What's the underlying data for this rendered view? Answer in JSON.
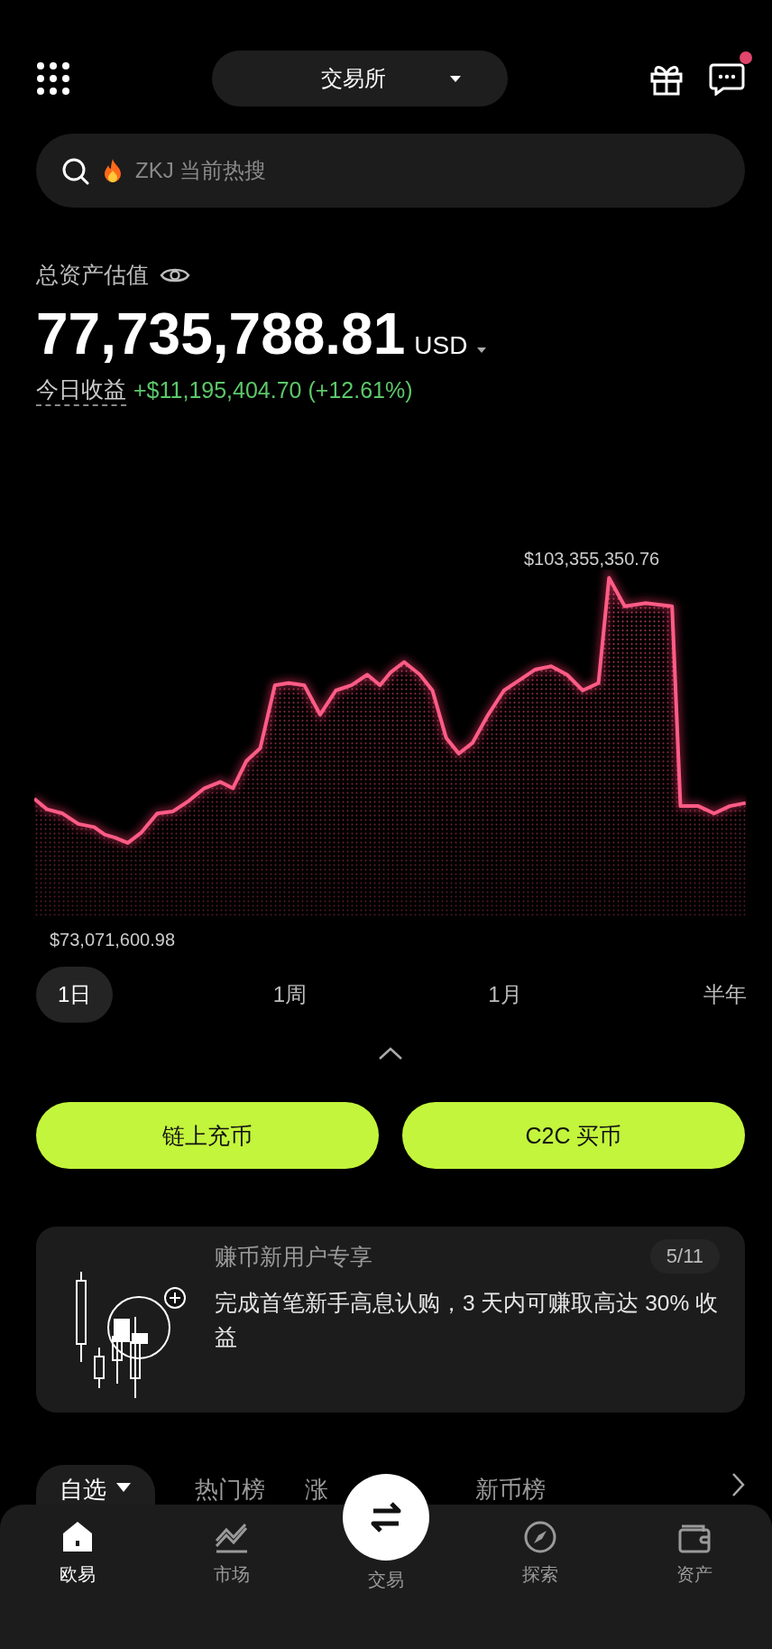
{
  "header": {
    "exchange_selector": "交易所",
    "message_unread": true
  },
  "search": {
    "placeholder": "ZKJ 当前热搜"
  },
  "balance": {
    "label": "总资产估值",
    "amount": "77,735,788.81",
    "currency": "USD",
    "pnl_label": "今日收益",
    "pnl": "+$11,195,404.70 (+12.61%)"
  },
  "chart": {
    "max_label": "$103,355,350.76",
    "min_label": "$73,071,600.98"
  },
  "ranges": [
    {
      "label": "1日",
      "selected": true
    },
    {
      "label": "1周",
      "selected": false
    },
    {
      "label": "1月",
      "selected": false
    },
    {
      "label": "半年",
      "selected": false
    }
  ],
  "actions": [
    "链上充币",
    "C2C 买币"
  ],
  "promo": {
    "title": "赚币新用户专享",
    "page": "5/11",
    "text": "完成首笔新手高息认购，3 天内可赚取高达 30% 收益"
  },
  "market_tabs": [
    {
      "label": "自选",
      "selected": true,
      "dropdown": true
    },
    {
      "label": "热门榜",
      "selected": false,
      "dropdown": false
    },
    {
      "label": "涨",
      "selected": false,
      "dropdown": false
    },
    {
      "label": "新币榜",
      "selected": false,
      "dropdown": false
    }
  ],
  "nav": [
    {
      "label": "欧易",
      "kind": "home",
      "selected": true
    },
    {
      "label": "市场",
      "kind": "market",
      "selected": false
    },
    {
      "label": "交易",
      "kind": "trade",
      "selected": false
    },
    {
      "label": "探索",
      "kind": "explore",
      "selected": false
    },
    {
      "label": "资产",
      "kind": "wallet",
      "selected": false
    }
  ]
}
